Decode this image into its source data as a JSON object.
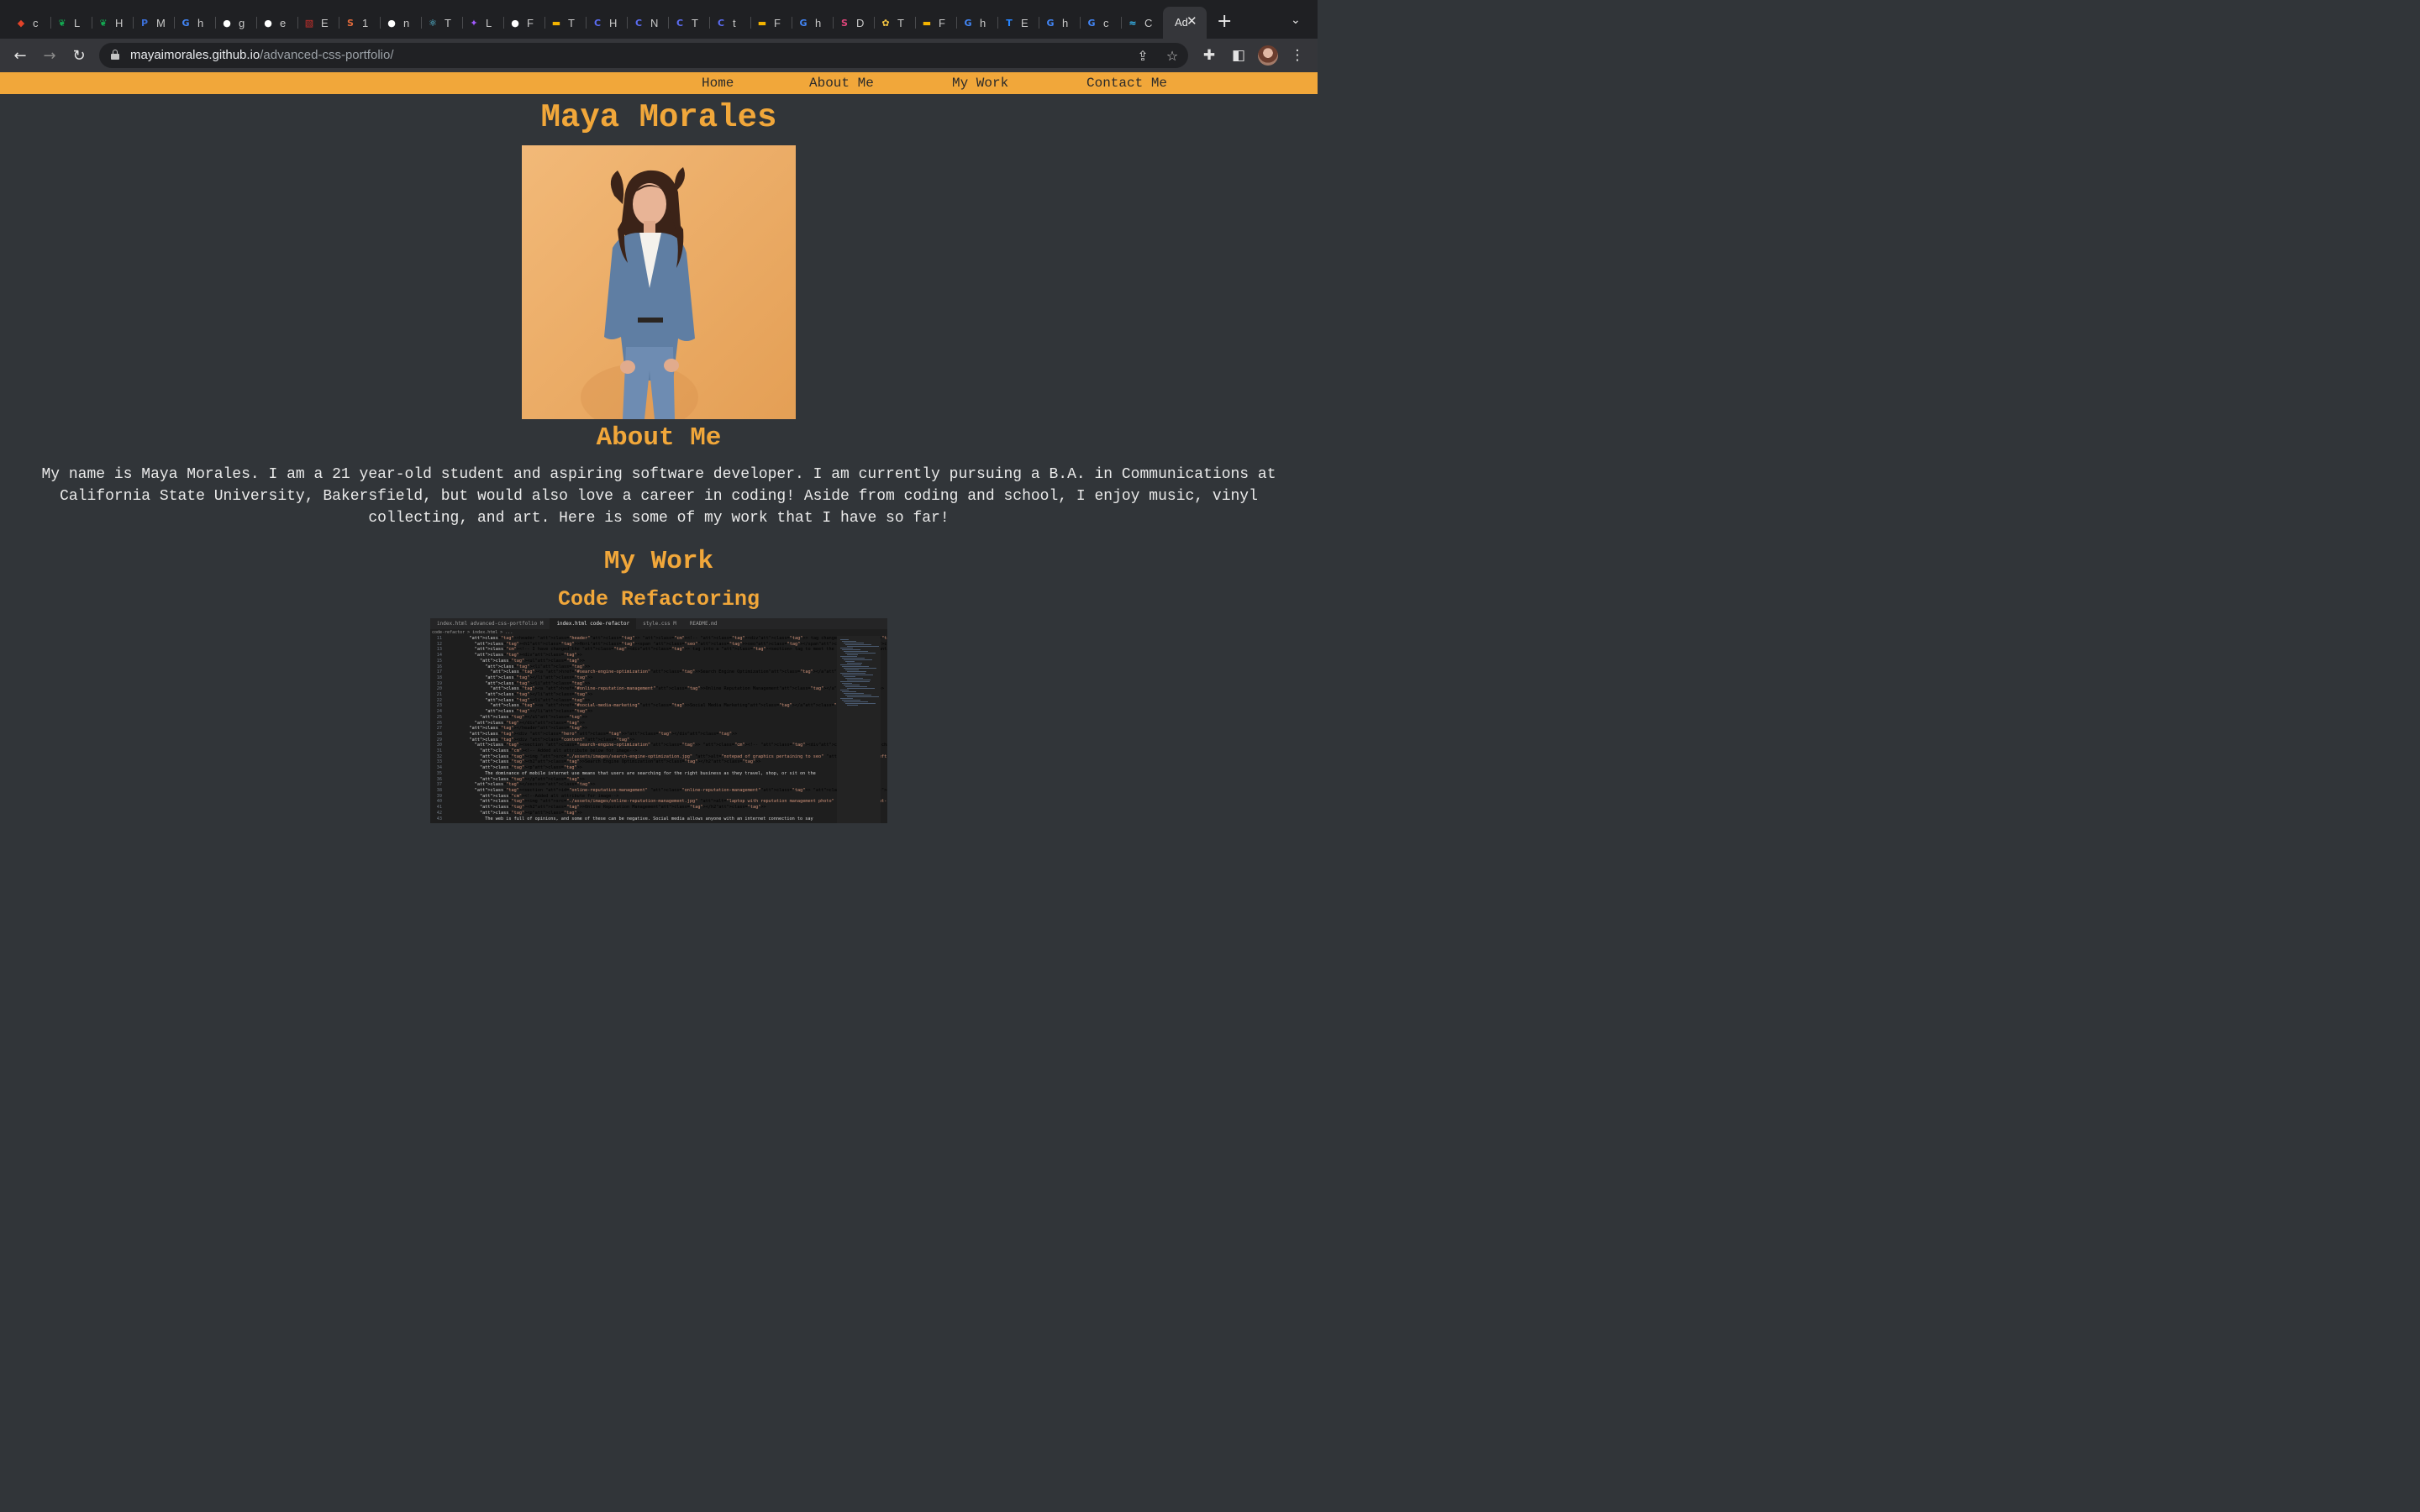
{
  "browser": {
    "tabs": [
      {
        "icon": "gitlab-icon",
        "label": "c",
        "color": "#e24329"
      },
      {
        "icon": "leaf-icon",
        "label": "L",
        "color": "#13aa52"
      },
      {
        "icon": "leaf-icon",
        "label": "H",
        "color": "#13aa52"
      },
      {
        "icon": "p-icon",
        "label": "M",
        "color": "#3b6fd8"
      },
      {
        "icon": "google-icon",
        "label": "h",
        "color": "#4285f4"
      },
      {
        "icon": "github-icon",
        "label": "g",
        "color": "#ffffff"
      },
      {
        "icon": "github-icon",
        "label": "e",
        "color": "#ffffff"
      },
      {
        "icon": "bookmark-icon",
        "label": "E",
        "color": "#c9302c"
      },
      {
        "icon": "swirl-icon",
        "label": "1",
        "color": "#e06a3b"
      },
      {
        "icon": "github-icon",
        "label": "n",
        "color": "#ffffff"
      },
      {
        "icon": "react-icon",
        "label": "T",
        "color": "#61dafb"
      },
      {
        "icon": "figma-icon",
        "label": "L",
        "color": "#a259ff"
      },
      {
        "icon": "github-icon",
        "label": "F",
        "color": "#ffffff"
      },
      {
        "icon": "slides-icon",
        "label": "T",
        "color": "#f4b400"
      },
      {
        "icon": "c-icon",
        "label": "H",
        "color": "#5b6cf2"
      },
      {
        "icon": "c-icon",
        "label": "N",
        "color": "#5b6cf2"
      },
      {
        "icon": "c-icon",
        "label": "T",
        "color": "#5b6cf2"
      },
      {
        "icon": "c-icon",
        "label": "t",
        "color": "#5b6cf2"
      },
      {
        "icon": "slides-icon",
        "label": "F",
        "color": "#f4b400"
      },
      {
        "icon": "google-icon",
        "label": "h",
        "color": "#4285f4"
      },
      {
        "icon": "s-icon",
        "label": "D",
        "color": "#e0457b"
      },
      {
        "icon": "flower-icon",
        "label": "T",
        "color": "#f4c542"
      },
      {
        "icon": "slides-icon",
        "label": "F",
        "color": "#f4b400"
      },
      {
        "icon": "google-icon",
        "label": "h",
        "color": "#4285f4"
      },
      {
        "icon": "t-icon",
        "label": "E",
        "color": "#2684ff"
      },
      {
        "icon": "google-icon",
        "label": "h",
        "color": "#4285f4"
      },
      {
        "icon": "google-icon",
        "label": "c",
        "color": "#4285f4"
      },
      {
        "icon": "tailwind-icon",
        "label": "C",
        "color": "#38bdf8"
      }
    ],
    "active_tab_label": "Ad",
    "url_host": "mayaimorales.github.io",
    "url_path": "/advanced-css-portfolio/"
  },
  "site": {
    "nav": [
      "Home",
      "About Me",
      "My Work",
      "Contact Me"
    ],
    "name": "Maya Morales",
    "about_heading": "About Me",
    "about_text": "My name is Maya Morales. I am a 21 year-old student and aspiring software developer. I am currently pursuing a B.A. in Communications at California State University, Bakersfield, but would also love a career in coding! Aside from coding and school, I enjoy music, vinyl collecting, and art. Here is some of my work that I have so far!",
    "work_heading": "My Work",
    "project_title": "Code Refactoring"
  },
  "code_screenshot": {
    "tabs": [
      "index.html advanced-css-portfolio M",
      "index.html code-refactor",
      "style.css M",
      "README.md"
    ],
    "breadcrumb": "code-refactor > index.html > ...",
    "lines": [
      {
        "n": "11",
        "code": "    <header class=\"header\"> <!-- <div> tag changed to <header> -->"
      },
      {
        "n": "12",
        "code": "      <h1>Hori<span class=\"seo\">seo</span></h1>"
      },
      {
        "n": "13",
        "code": "      <!-- I have changed the <div> tag into a <section> tag to meet the criteria for semantic HTML elements-->"
      },
      {
        "n": "14",
        "code": "      <div>"
      },
      {
        "n": "15",
        "code": "        <ul>"
      },
      {
        "n": "16",
        "code": "          <li>"
      },
      {
        "n": "17",
        "code": "            <a href=\"#search-engine-optimization\">Search Engine Optimization</a>"
      },
      {
        "n": "18",
        "code": "          </li>"
      },
      {
        "n": "19",
        "code": "          <li>"
      },
      {
        "n": "20",
        "code": "            <a href=\"#online-reputation-management\">Online Reputation Management</a>"
      },
      {
        "n": "21",
        "code": "          </li>"
      },
      {
        "n": "22",
        "code": "          <li>"
      },
      {
        "n": "23",
        "code": "            <a href=\"#social-media-marketing\">Social Media Marketing</a>"
      },
      {
        "n": "24",
        "code": "          </li>"
      },
      {
        "n": "25",
        "code": "        </ul>"
      },
      {
        "n": "26",
        "code": "      </div>"
      },
      {
        "n": "27",
        "code": "    </header>"
      },
      {
        "n": "28",
        "code": "    <div class=\"hero\"></div>"
      },
      {
        "n": "29",
        "code": "    <div class=\"content\">"
      },
      {
        "n": "30",
        "code": "      <section class=\"search-engine-optimization\"> <!-- <div> tag changed to <section> tag -->"
      },
      {
        "n": "31",
        "code": "        <!-- Added alt attribute below for image-->"
      },
      {
        "n": "32",
        "code": "        <img src=\"./assets/images/search-engine-optimization.jpg\" alt=\"notepad of graphics pertaining to seo\" class=\"float-left\" />"
      },
      {
        "n": "33",
        "code": "        <h2>Search Engine Optimization</h2>"
      },
      {
        "n": "34",
        "code": "        <p>"
      },
      {
        "n": "35",
        "code": "          The dominance of mobile internet use means that users are searching for the right business as they travel, shop, or sit on the"
      },
      {
        "n": "36",
        "code": "        </p>"
      },
      {
        "n": "37",
        "code": "      </section>"
      },
      {
        "n": "38",
        "code": "      <section id=\"online-reputation-management\" class=\"online-reputation-management\"> <!-- <div> tag changed to <section> tag -->"
      },
      {
        "n": "39",
        "code": "        <!--Added alt attribute for image-->"
      },
      {
        "n": "40",
        "code": "        <img src=\"./assets/images/online-reputation-management.jpg\" alt=\"laptop with reputation management photo\" class=\"float-right\" />"
      },
      {
        "n": "41",
        "code": "        <h2>Online Reputation Management</h2>"
      },
      {
        "n": "42",
        "code": "        <p>"
      },
      {
        "n": "43",
        "code": "          The web is full of opinions, and some of these can be negative. Social media allows anyone with an internet connection to say"
      }
    ]
  }
}
